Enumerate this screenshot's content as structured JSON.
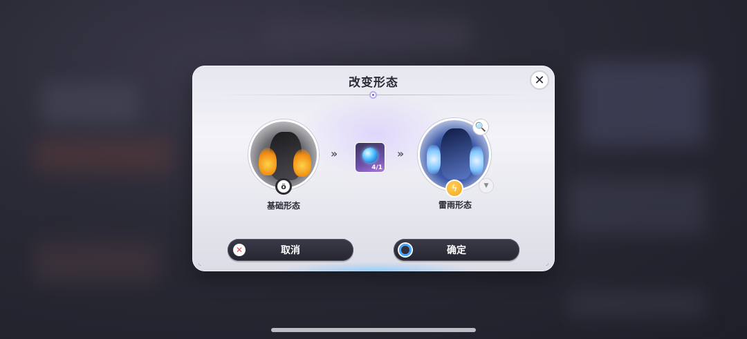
{
  "dialog": {
    "title": "改变形态",
    "close_symbol": "✕",
    "from_form": {
      "label": "基础形态",
      "badge_symbol": "ö",
      "image_icon": "dark-flame-creature-portrait"
    },
    "to_form": {
      "label": "雷雨形态",
      "badge_symbol": "ϟ",
      "image_icon": "storm-creature-portrait"
    },
    "arrow_symbol": "››",
    "cost_item": {
      "count_text": "4/1",
      "icon": "blue-orb-item-icon"
    },
    "magnifier_symbol": "🔍",
    "dropdown_symbol": "▼",
    "cancel_button": {
      "label": "取消",
      "icon_symbol": "✕"
    },
    "confirm_button": {
      "label": "确定"
    },
    "corner_symbol": "◟ ◞"
  },
  "colors": {
    "dialog_bg": "#ececf3",
    "button_bg": "#2c2c3a",
    "cancel_icon": "#e0505a",
    "confirm_icon": "#4aa8ff",
    "weather_badge": "#f2a41a"
  }
}
